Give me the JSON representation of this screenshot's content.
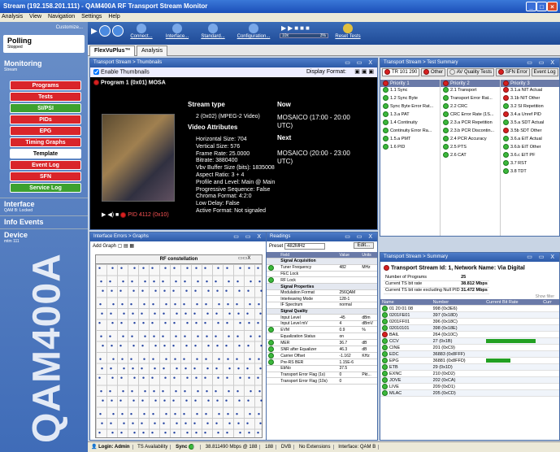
{
  "window": {
    "title": "Stream (192.158.201.111) - QAM400A RF Transport Stream Monitor"
  },
  "menu": [
    "Analysis",
    "View",
    "Navigation",
    "Settings",
    "Help"
  ],
  "nav": {
    "customize": "Customize...",
    "polling": {
      "label": "Polling",
      "sub": "Stopped"
    },
    "monitoring": {
      "label": "Monitoring",
      "sub": "Stream"
    },
    "items": [
      "Programs",
      "Tests",
      "SI/PSI",
      "PIDs",
      "EPG",
      "Timing Graphs",
      "Template",
      "Event Log",
      "SFN",
      "Service Log"
    ],
    "interface": {
      "label": "Interface",
      "sub": "QAM B: Locked"
    },
    "info": {
      "label": "Info Events"
    },
    "device": {
      "label": "Device",
      "sub": "mtm 111"
    },
    "brand": "QAM400A"
  },
  "toolbar": {
    "items": [
      "Connect...",
      "Interface...",
      "Standard...",
      "Configuration...",
      "Reset Tests"
    ],
    "speed_left": "10x",
    "speed_right": "3%"
  },
  "tabs": {
    "flexvu": "FlexVuPlus™",
    "analysis": "Analysis"
  },
  "thumbs": {
    "title": "Transport Stream > Thumbnails",
    "enable": "Enable Thumbnails",
    "display_format": "Display Format:",
    "program": "Program 1 (0x01) MOSA",
    "stream_type_label": "Stream type",
    "stream_type": "2 (0x02) (MPEG-2 Video)",
    "attrs_label": "Video Attributes",
    "attrs": [
      "Horizontal Size: 704",
      "Vertical Size: 576",
      "Frame Rate: 25.0000",
      "Bitrate: 3880400",
      "Vbv Buffer Size (bits): 1835008",
      "Aspect Ratio: 3 + 4",
      "Profile and Level: Main @ Main",
      "Progressive Sequence: False",
      "Chroma Format: 4:2:0",
      "Low Delay: False",
      "Active Format: Not signaled"
    ],
    "now_label": "Now",
    "now": "MOSAICO (17:00 - 20:00 UTC)",
    "next_label": "Next",
    "next": "MOSAICO (20:00 - 23:00 UTC)",
    "pid": "PID 4112 (0x10)"
  },
  "summary_tests": {
    "title": "Transport Stream > Test Summary",
    "tabs": [
      "TR 101 290",
      "Other",
      "AV Quality Tests",
      "SFN Error",
      "Event Log"
    ],
    "cols": [
      {
        "head": "Priority 1",
        "items": [
          [
            "1.1 Sync",
            "g"
          ],
          [
            "1.2 Sync Byte",
            "g"
          ],
          [
            "Sync Byte Error Rat...",
            "g"
          ],
          [
            "1.3.a PAT",
            "g"
          ],
          [
            "1.4 Continuity",
            "g"
          ],
          [
            "Continuity Error Ra...",
            "g"
          ],
          [
            "1.5.a PMT",
            "g"
          ],
          [
            "1.6 PID",
            "g"
          ]
        ]
      },
      {
        "head": "Priority 2",
        "items": [
          [
            "2.1 Transport",
            "g"
          ],
          [
            "Transport Error Rat...",
            "g"
          ],
          [
            "2.2 CRC",
            "g"
          ],
          [
            "CRC Error Rate (1S...",
            "g"
          ],
          [
            "2.3.a PCR Repetition",
            "g"
          ],
          [
            "2.3.b PCR Discontin...",
            "g"
          ],
          [
            "2.4 PCR Accuracy",
            "g"
          ],
          [
            "2.5 PTS",
            "g"
          ],
          [
            "2.6 CAT",
            "g"
          ]
        ]
      },
      {
        "head": "Priority 3",
        "items": [
          [
            "3.1.a NIT Actual",
            "r"
          ],
          [
            "3.1b NIT Other",
            "r"
          ],
          [
            "3.2 SI Repetition",
            "g"
          ],
          [
            "3.4.a Unref PID",
            "r"
          ],
          [
            "3.5.a SDT Actual",
            "g"
          ],
          [
            "3.5b SDT Other",
            "r"
          ],
          [
            "3.6.a EIT Actual",
            "g"
          ],
          [
            "3.6.b EIT Other",
            "g"
          ],
          [
            "3.6.c EIT PF",
            "g"
          ],
          [
            "3.7 RST",
            "g"
          ],
          [
            "3.8 TDT",
            "g"
          ]
        ]
      }
    ]
  },
  "graphs": {
    "title": "Interface Errors > Graphs",
    "add_graph": "Add Graph",
    "chart_title": "RF constellation"
  },
  "readings": {
    "title": "Readings",
    "preset_label": "Preset",
    "preset_value": "482MHz",
    "edit": "Edit...",
    "headers": [
      "Field",
      "Value",
      "Units"
    ],
    "rows": [
      [
        "sec",
        "Signal Acquisition",
        "",
        ""
      ],
      [
        "g",
        "Tuner Frequency",
        "482",
        "MHz"
      ],
      [
        "",
        "FEC Lock",
        "",
        ""
      ],
      [
        "g",
        "RF Lock",
        "",
        ""
      ],
      [
        "sec",
        "Signal Properties",
        "",
        ""
      ],
      [
        "",
        "Modulation Format",
        "256QAM",
        ""
      ],
      [
        "",
        "Interleaving Mode",
        "128-1",
        ""
      ],
      [
        "",
        "IF Spectrum",
        "normal",
        ""
      ],
      [
        "sec",
        "Signal Quality",
        "",
        ""
      ],
      [
        "",
        "Input Level",
        "-45",
        "dBm"
      ],
      [
        "",
        "Input Level mV",
        "4",
        "dBmV"
      ],
      [
        "g",
        "EVM",
        "0.9",
        "%"
      ],
      [
        "",
        "Equalization Status",
        "on",
        ""
      ],
      [
        "g",
        "MER",
        "36.7",
        "dB"
      ],
      [
        "g",
        "SNR after Equalizer",
        "46.3",
        "dB"
      ],
      [
        "g",
        "Carrier Offset",
        "-1.162",
        "KHz"
      ],
      [
        "g",
        "Pre-RS BER",
        "1.15E-6",
        ""
      ],
      [
        "",
        "EbNo",
        "37.5",
        ""
      ],
      [
        "",
        "Transport Error Flag (1s)",
        "0",
        "Pkt..."
      ],
      [
        "",
        "Transport Error Flag (10s)",
        "0",
        ""
      ]
    ]
  },
  "summary": {
    "title": "Transport Stream > Summary",
    "header": "Transport Stream Id: 1, Network Name: Via Digital",
    "num_programs_label": "Number of Programs",
    "num_programs": "25",
    "ts_rate_label": "Current TS bit rate",
    "ts_rate": "38.812 Mbps",
    "ts_rate_null_label": "Current TS bit rate excluding Null PID",
    "ts_rate_null": "31.472 Mbps",
    "show_filter": "Show filter",
    "headers": [
      "Name",
      "Number",
      "Current Bit Rate",
      "Curr"
    ],
    "rows": [
      [
        "g",
        "01 20 01 08",
        "998 (0x3E6)",
        0
      ],
      [
        "g",
        "0201FE01",
        "397 (0x18D)",
        0
      ],
      [
        "g",
        "0201FF01",
        "396 (0x18C)",
        0
      ],
      [
        "g",
        "02010101",
        "398 (0x18E)",
        0
      ],
      [
        "r",
        "BAIL",
        "264 (0x10C)",
        0
      ],
      [
        "g",
        "CCV",
        "27 (0x1B)",
        0.92
      ],
      [
        "g",
        "CINE",
        "201 (0xC9)",
        0
      ],
      [
        "g",
        "EDC",
        "36883 (0x8FFF)",
        0
      ],
      [
        "g",
        "EPG",
        "36881 (0x8FFD)",
        0.45
      ],
      [
        "g",
        "ETB",
        "29 (0x1D)",
        0
      ],
      [
        "g",
        "EXNC",
        "210 (0xD2)",
        0
      ],
      [
        "g",
        "JOVE",
        "202 (0xCA)",
        0
      ],
      [
        "g",
        "LIVE",
        "209 (0xD1)",
        0
      ],
      [
        "g",
        "MLAC",
        "205 (0xCD)",
        0
      ]
    ]
  },
  "status": {
    "items": [
      "Login: Admin",
      "TS Availability",
      "Sync",
      "38.811490 Mbps @ 188",
      "188",
      "DVB",
      "No Extensions",
      "Interface: QAM B"
    ]
  }
}
